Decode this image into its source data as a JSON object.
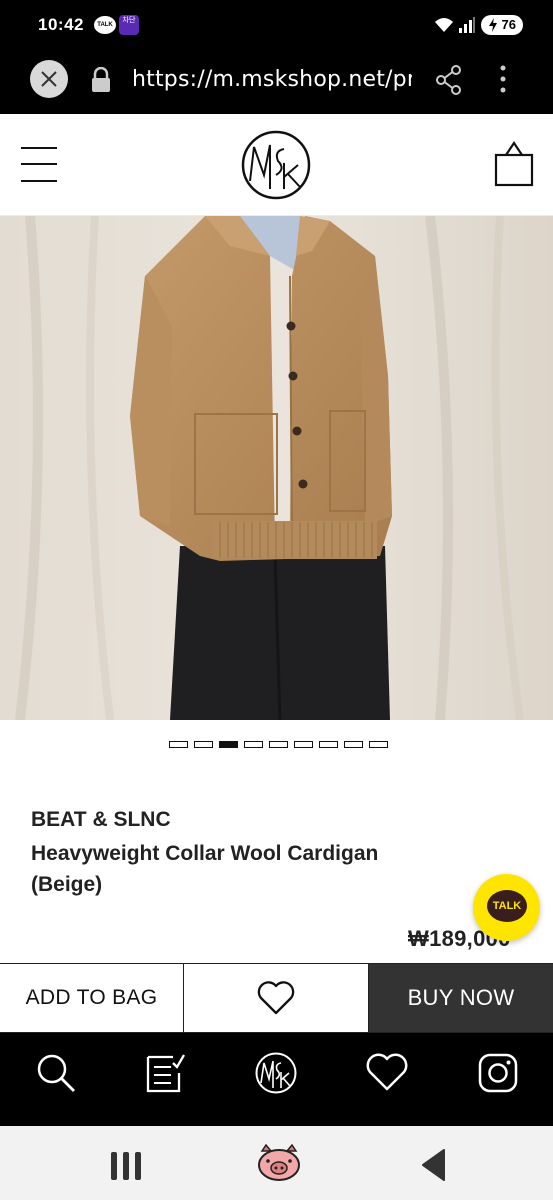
{
  "status_bar": {
    "time": "10:42",
    "talk_badge": "TALK",
    "notif_badge": "차단",
    "battery": "76"
  },
  "browser": {
    "url": "https://m.mskshop.net/pr",
    "icons": [
      "close-icon",
      "lock-icon",
      "share-icon",
      "more-vertical-icon"
    ]
  },
  "header": {
    "icons": [
      "menu-icon",
      "msk-logo",
      "shopping-bag-icon"
    ]
  },
  "carousel": {
    "count": 9,
    "active_index": 2
  },
  "product": {
    "brand": "BEAT & SLNC",
    "name_line1": "Heavyweight Collar Wool Cardigan",
    "name_line2": "(Beige)",
    "price": "₩189,000"
  },
  "kakao_talk": {
    "label": "TALK",
    "color": "#fee500"
  },
  "actions": {
    "add_to_bag": "ADD TO BAG",
    "buy_now": "BUY NOW"
  },
  "bottom_nav": {
    "icons": [
      "search-icon",
      "list-icon",
      "msk-logo-icon",
      "heart-icon",
      "instagram-icon"
    ]
  },
  "system_nav": {
    "icons": [
      "recent-apps-icon",
      "home-icon",
      "back-icon"
    ]
  }
}
